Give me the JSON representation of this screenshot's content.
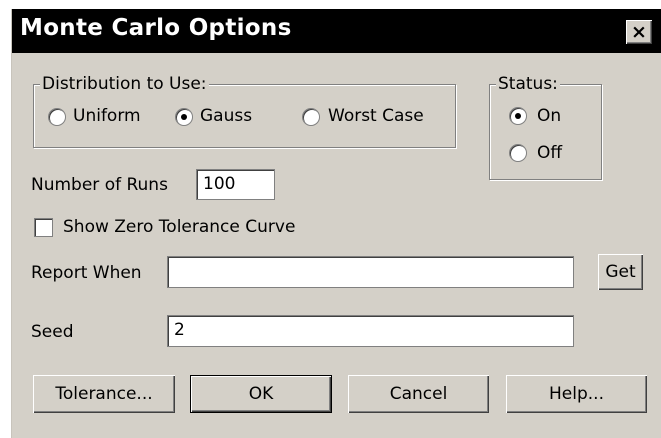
{
  "window": {
    "title": "Monte Carlo Options",
    "close_label": "×"
  },
  "distribution": {
    "legend": "Distribution to Use:",
    "options": [
      {
        "label": "Uniform",
        "checked": false
      },
      {
        "label": "Gauss",
        "checked": true
      },
      {
        "label": "Worst Case",
        "checked": false
      }
    ]
  },
  "status": {
    "legend": "Status:",
    "options": [
      {
        "label": "On",
        "checked": true
      },
      {
        "label": "Off",
        "checked": false
      }
    ]
  },
  "runs": {
    "label": "Number of Runs",
    "value": "100"
  },
  "zero_tolerance": {
    "label": "Show Zero Tolerance Curve",
    "checked": false
  },
  "report_when": {
    "label": "Report When",
    "value": "",
    "get_label": "Get"
  },
  "seed": {
    "label": "Seed",
    "value": "2"
  },
  "buttons": {
    "tolerance": "Tolerance...",
    "ok": "OK",
    "cancel": "Cancel",
    "help": "Help..."
  }
}
